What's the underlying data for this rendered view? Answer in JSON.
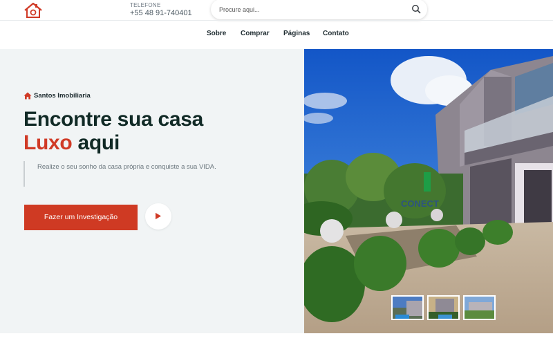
{
  "colors": {
    "accent": "#d03a26",
    "dark": "#112a26",
    "hero_bg": "#f1f4f5"
  },
  "header": {
    "logo_icon": "house-logo-icon",
    "phone_label": "TELEFONE",
    "phone_number": "+55 48 91-740401",
    "search": {
      "placeholder": "Procure aqui...",
      "icon": "search-icon"
    }
  },
  "nav": {
    "items": [
      {
        "label": "Sobre"
      },
      {
        "label": "Comprar"
      },
      {
        "label": "Páginas"
      },
      {
        "label": "Contato"
      }
    ]
  },
  "hero": {
    "brand_icon": "house-icon",
    "brand": "Santos Imobiliaria",
    "headline_line1": "Encontre sua casa",
    "headline_accent": "Luxo",
    "headline_rest": "aqui",
    "description": "Realize o seu sonho da casa própria e conquiste a sua VIDA.",
    "cta_label": "Fazer um Investigação",
    "play_icon": "play-icon",
    "image_watermark": "CONECT",
    "thumbnails": [
      {
        "name": "thumb-1"
      },
      {
        "name": "thumb-2"
      },
      {
        "name": "thumb-3"
      }
    ]
  }
}
